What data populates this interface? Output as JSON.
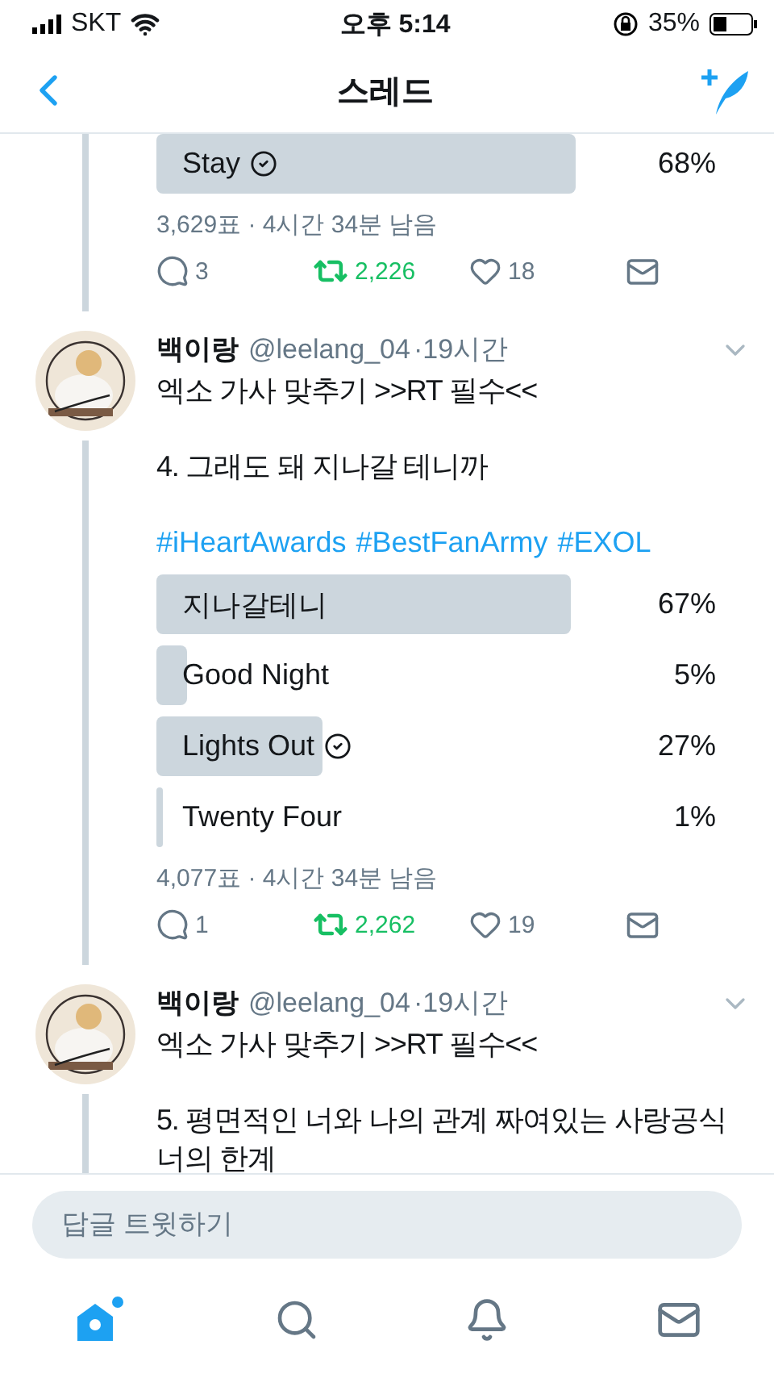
{
  "status_bar": {
    "carrier": "SKT",
    "time": "오후 5:14",
    "battery": "35%"
  },
  "header": {
    "title": "스레드"
  },
  "tweets": [
    {
      "poll": {
        "options": [
          {
            "label": "Stay",
            "percent": "68%",
            "selected": true
          }
        ],
        "meta": "3,629표 · 4시간 34분 남음"
      },
      "actions": {
        "replies": "3",
        "retweets": "2,226",
        "retweeted": true,
        "likes": "18",
        "liked": false
      }
    },
    {
      "author": {
        "name": "백이랑",
        "handle": "@leelang_04",
        "time": "·19시간"
      },
      "paragraphs": [
        "엑소 가사 맞추기 >>RT 필수<<",
        "4. 그래도 돼 지나갈 테니까"
      ],
      "hashtags": [
        "#iHeartAwards",
        "#BestFanArmy",
        "#EXOL"
      ],
      "poll": {
        "options": [
          {
            "label": "지나갈테니",
            "percent": "67%",
            "selected": false
          },
          {
            "label": "Good Night",
            "percent": "5%",
            "selected": false
          },
          {
            "label": "Lights Out",
            "percent": "27%",
            "selected": true
          },
          {
            "label": "Twenty Four",
            "percent": "1%",
            "selected": false
          }
        ],
        "meta": "4,077표 · 4시간 34분 남음"
      },
      "actions": {
        "replies": "1",
        "retweets": "2,262",
        "retweeted": true,
        "likes": "19",
        "liked": false
      }
    },
    {
      "author": {
        "name": "백이랑",
        "handle": "@leelang_04",
        "time": "·19시간"
      },
      "paragraphs": [
        "엑소 가사 맞추기 >>RT 필수<<",
        "5. 평면적인 너와 나의 관계 짜여있는 사랑공식 너의 한계"
      ]
    }
  ],
  "reply_bar": {
    "placeholder": "답글 트윗하기"
  },
  "tabs": [
    {
      "kind": "home",
      "selected": true
    },
    {
      "kind": "search",
      "selected": false
    },
    {
      "kind": "notifications",
      "selected": false
    },
    {
      "kind": "messages",
      "selected": false
    }
  ]
}
